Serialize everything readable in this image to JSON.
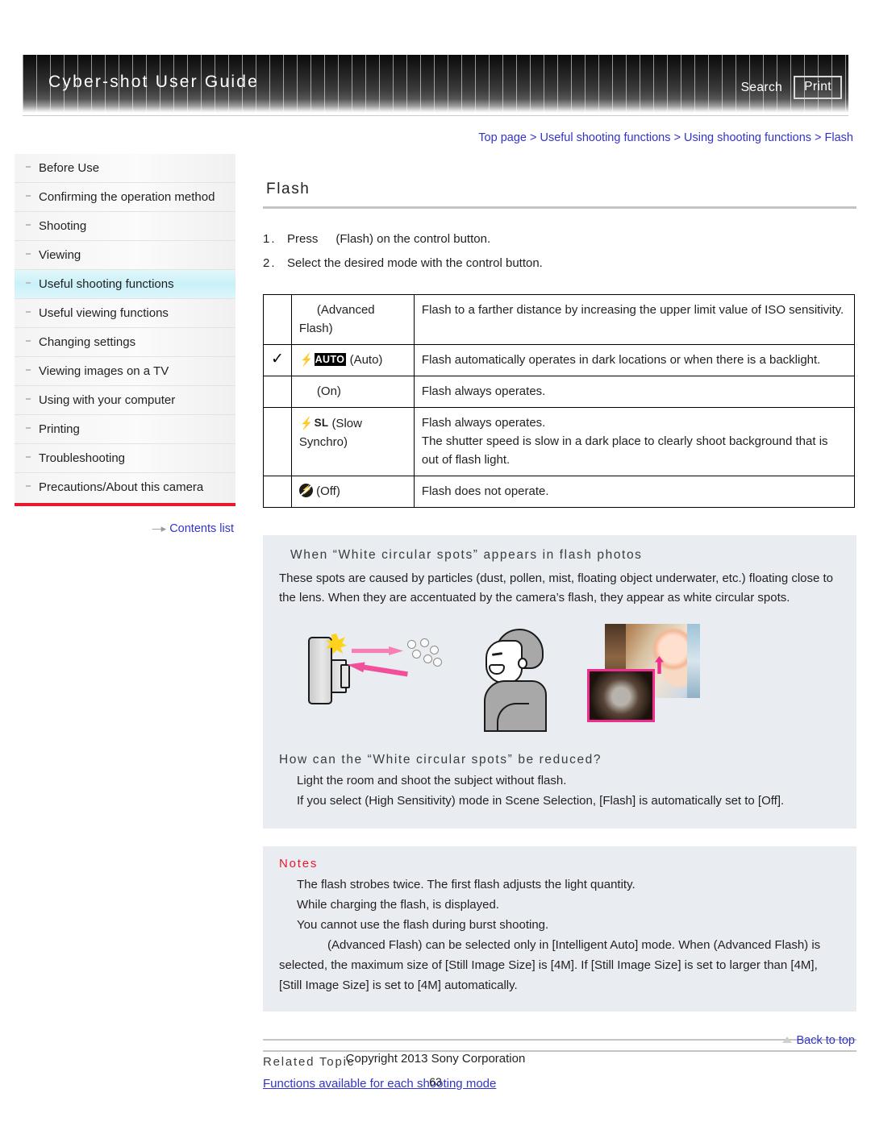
{
  "header": {
    "title": "Cyber-shot User Guide",
    "search_label": "Search",
    "print_label": "Print"
  },
  "breadcrumb": {
    "full": "Top page > Useful shooting functions > Using shooting functions > Flash",
    "items": [
      "Top page",
      "Useful shooting functions",
      "Using shooting functions",
      "Flash"
    ],
    "separator": ">",
    "color": "#3333cc"
  },
  "sidebar": {
    "items": [
      {
        "label": "Before Use",
        "active": false
      },
      {
        "label": "Confirming the operation method",
        "active": false
      },
      {
        "label": "Shooting",
        "active": false
      },
      {
        "label": "Viewing",
        "active": false
      },
      {
        "label": "Useful shooting functions",
        "active": true
      },
      {
        "label": "Useful viewing functions",
        "active": false
      },
      {
        "label": "Changing settings",
        "active": false
      },
      {
        "label": "Viewing images on a TV",
        "active": false
      },
      {
        "label": "Using with your computer",
        "active": false
      },
      {
        "label": "Printing",
        "active": false
      },
      {
        "label": "Troubleshooting",
        "active": false
      },
      {
        "label": "Precautions/About this camera",
        "active": false
      }
    ],
    "contents_list_label": "Contents list",
    "accent_color": "#e8192c",
    "active_color": "#c9f1f8"
  },
  "main": {
    "page_title": "Flash",
    "steps": [
      {
        "num": "1.",
        "pre": "Press",
        "icon": "flash-icon",
        "post": "(Flash) on the control button."
      },
      {
        "num": "2.",
        "pre": "Select the desired mode with the control button.",
        "icon": "",
        "post": ""
      }
    ],
    "table": {
      "rows": [
        {
          "checked": false,
          "icon": "advanced-flash-icon",
          "icon_kind": "gap",
          "mode": "(Advanced Flash)",
          "desc": "Flash to a farther distance by increasing the upper limit value of ISO sensitivity."
        },
        {
          "checked": true,
          "icon": "flash-auto-icon",
          "icon_kind": "auto-badge",
          "badge_text": "AUTO",
          "mode": "(Auto)",
          "desc": "Flash automatically operates in dark locations or when there is a backlight."
        },
        {
          "checked": false,
          "icon": "flash-on-icon",
          "icon_kind": "gap",
          "mode": "(On)",
          "desc": "Flash always operates."
        },
        {
          "checked": false,
          "icon": "flash-slow-synchro-icon",
          "icon_kind": "sl-badge",
          "badge_text": "SL",
          "mode": "(Slow Synchro)",
          "desc": "Flash always operates.\nThe shutter speed is slow in a dark place to clearly shoot background that is out of flash light."
        },
        {
          "checked": false,
          "icon": "flash-off-icon",
          "icon_kind": "off-badge",
          "mode": "(Off)",
          "desc": "Flash does not operate."
        }
      ],
      "check_glyph": "✓"
    },
    "info_panel": {
      "heading": "When “White circular spots” appears in flash photos",
      "body": "These spots are caused by particles (dust, pollen, mist, floating object underwater, etc.) floating close to the lens. When they are accentuated by the camera’s flash, they appear as white circular spots.",
      "sub_heading": "How can the “White circular spots” be reduced?",
      "bullets": [
        "Light the room and shoot the subject without flash.",
        "If you select    (High Sensitivity) mode in Scene Selection, [Flash] is automatically set to [Off]."
      ],
      "background": "#e9edf2"
    },
    "notes": {
      "heading": "Notes",
      "heading_color": "#e8192c",
      "lines": [
        "The flash strobes twice. The first flash adjusts the light quantity.",
        "While charging the flash,         is displayed.",
        "You cannot use the flash during burst shooting."
      ],
      "long_note": "(Advanced Flash) can be selected only in [Intelligent Auto] mode. When              (Advanced Flash) is selected, the maximum size of [Still Image Size] is [4M]. If [Still Image Size] is set to larger than [4M], [Still Image Size] is set to [4M] automatically."
    },
    "related": {
      "heading": "Related Topic",
      "link": "Functions available for each shooting mode"
    }
  },
  "footer": {
    "back_to_top": "Back to top",
    "copyright": "Copyright 2013 Sony Corporation",
    "page_number": "63"
  }
}
